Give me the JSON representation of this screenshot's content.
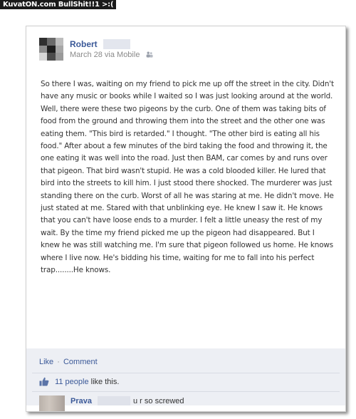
{
  "watermark": "KuvatON.com BullShit!!1 >:(",
  "post": {
    "author": "Robert",
    "date": "March 28 via Mobile",
    "privacy_icon": "friends-icon",
    "body": "So there I was, waiting on my friend to pick me up off the street in the city. Didn't have any music or books while I waited so I was just looking around at the world. Well, there were these two pigeons by the curb. One of them was taking bits of food from the ground and throwing them into the street and the other one was eating them. \"This bird is retarded.\" I thought. \"The other bird is eating all his food.\" After about a few minutes of the bird taking the food and throwing it, the one eating it was well into the road. Just then BAM, car comes by and runs over that pigeon. That bird wasn't stupid. He was a cold blooded killer. He lured that bird into the streets to kill him. I just stood there shocked. The murderer was just standing there on the curb. Worst of all he was staring at me. He didn't move. He just stated at me. Stared with that unblinking eye. He knew I saw it. He knows that you can't have loose ends to a murder. I felt a little uneasy the rest of my wait. By the time my friend picked me up the pigeon had disappeared. But I knew he was still watching me. I'm sure that pigeon followed us home. He knows where I live now. He's bidding his time, waiting for me to fall into his perfect trap........He knows."
  },
  "actions": {
    "like": "Like",
    "separator": "·",
    "comment": "Comment"
  },
  "likes": {
    "count_text": "11 people",
    "suffix": "like this."
  },
  "comment": {
    "author": "Prava",
    "text": "u r so screwed"
  },
  "colors": {
    "link": "#3b5998",
    "action_bar": "#edeff4"
  }
}
